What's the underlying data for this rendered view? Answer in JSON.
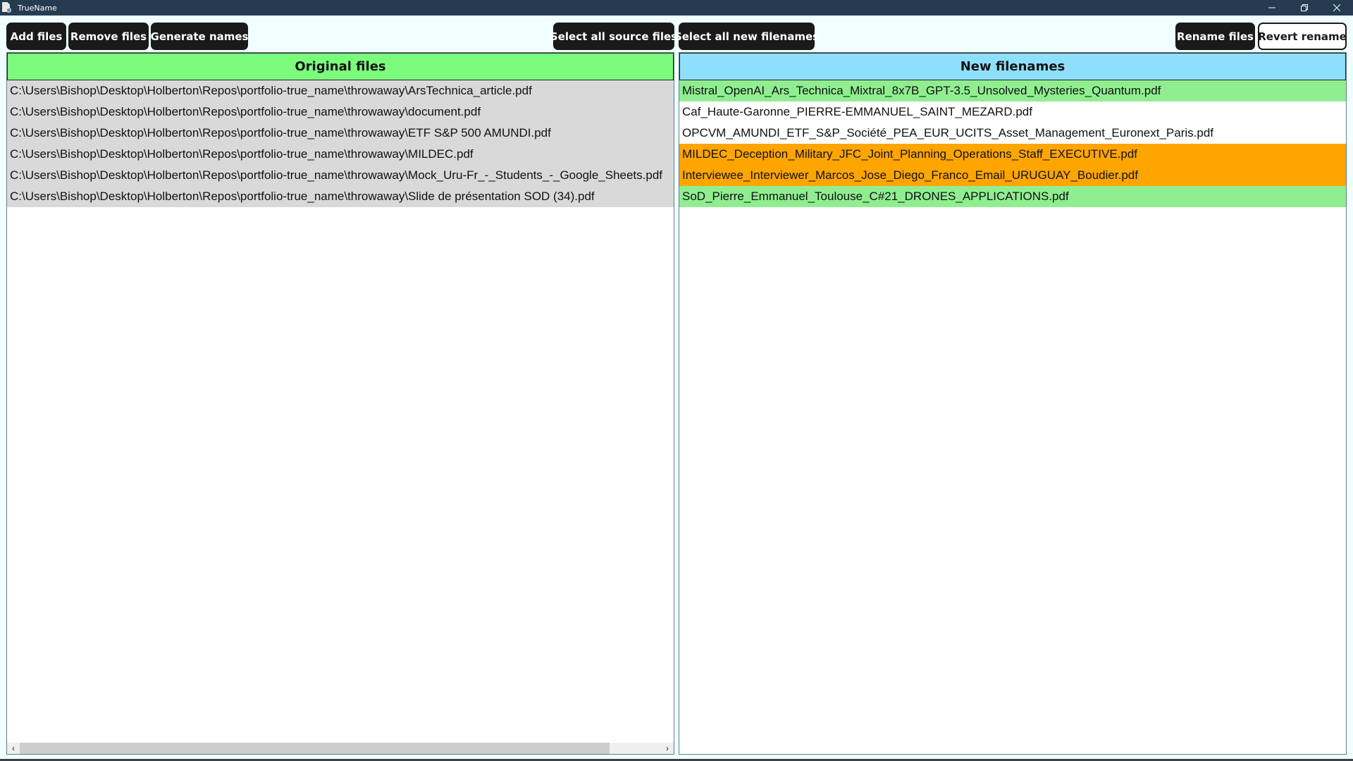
{
  "window": {
    "title": "TrueName",
    "controls": [
      "minimize",
      "restore",
      "close"
    ]
  },
  "toolbar": {
    "add_files": "Add files",
    "remove_files": "Remove files",
    "generate_names": "Generate names",
    "select_all_source": "Select all source files",
    "select_all_new": "Select all new filenames",
    "rename_files": "Rename files",
    "revert_rename": "Revert rename"
  },
  "left_panel": {
    "header": "Original files",
    "header_color": "#7cfc7c",
    "row_color": "#d9d9d9",
    "rows": [
      "C:\\Users\\Bishop\\Desktop\\Holberton\\Repos\\portfolio-true_name\\throwaway\\ArsTechnica_article.pdf",
      "C:\\Users\\Bishop\\Desktop\\Holberton\\Repos\\portfolio-true_name\\throwaway\\document.pdf",
      "C:\\Users\\Bishop\\Desktop\\Holberton\\Repos\\portfolio-true_name\\throwaway\\ETF S&P 500 AMUNDI.pdf",
      "C:\\Users\\Bishop\\Desktop\\Holberton\\Repos\\portfolio-true_name\\throwaway\\MILDEC.pdf",
      "C:\\Users\\Bishop\\Desktop\\Holberton\\Repos\\portfolio-true_name\\throwaway\\Mock_Uru-Fr_-_Students_-_Google_Sheets.pdf",
      "C:\\Users\\Bishop\\Desktop\\Holberton\\Repos\\portfolio-true_name\\throwaway\\Slide de présentation SOD (34).pdf"
    ],
    "scrollbar_thumb_fraction": 0.92
  },
  "right_panel": {
    "header": "New filenames",
    "header_color": "#8ee0fa",
    "rows": [
      {
        "name": "Mistral_OpenAI_Ars_Technica_Mixtral_8x7B_GPT-3.5_Unsolved_Mysteries_Quantum.pdf",
        "color": "#90ee90"
      },
      {
        "name": "Caf_Haute-Garonne_PIERRE-EMMANUEL_SAINT_MEZARD.pdf",
        "color": "#ffffff"
      },
      {
        "name": "OPCVM_AMUNDI_ETF_S&P_Société_PEA_EUR_UCITS_Asset_Management_Euronext_Paris.pdf",
        "color": "#ffffff"
      },
      {
        "name": "MILDEC_Deception_Military_JFC_Joint_Planning_Operations_Staff_EXECUTIVE.pdf",
        "color": "#ffa500"
      },
      {
        "name": "Interviewee_Interviewer_Marcos_Jose_Diego_Franco_Email_URUGUAY_Boudier.pdf",
        "color": "#ffa500"
      },
      {
        "name": "SoD_Pierre_Emmanuel_Toulouse_C#21_DRONES_APPLICATIONS.pdf",
        "color": "#90ee90"
      }
    ]
  }
}
